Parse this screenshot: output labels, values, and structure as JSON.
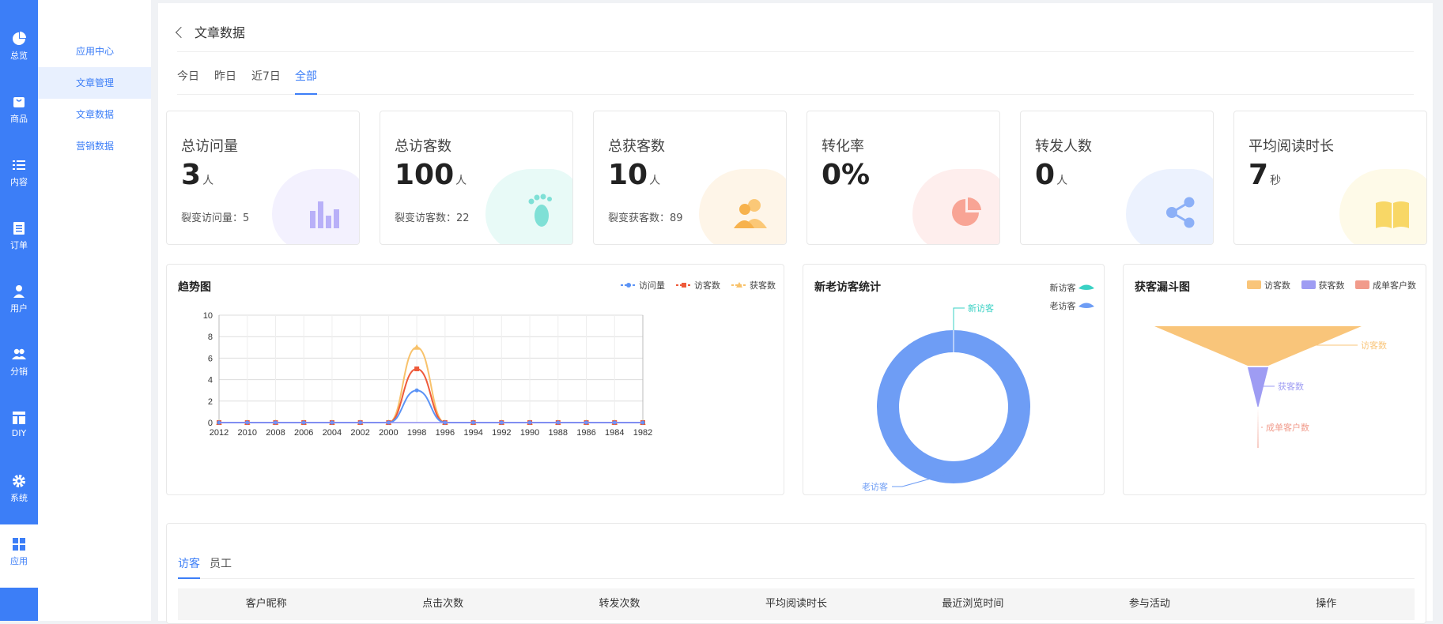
{
  "rail": [
    {
      "label": "总览",
      "icon": "pie-icon"
    },
    {
      "label": "商品",
      "icon": "bag-icon"
    },
    {
      "label": "内容",
      "icon": "list-icon"
    },
    {
      "label": "订单",
      "icon": "document-icon"
    },
    {
      "label": "用户",
      "icon": "user-icon"
    },
    {
      "label": "分销",
      "icon": "users-icon"
    },
    {
      "label": "DIY",
      "icon": "layout-icon"
    },
    {
      "label": "系统",
      "icon": "gear-icon"
    },
    {
      "label": "应用",
      "icon": "grid-icon"
    }
  ],
  "subnav": [
    "应用中心",
    "文章管理",
    "文章数据",
    "营销数据"
  ],
  "page_title": "文章数据",
  "tabs": [
    "今日",
    "昨日",
    "近7日",
    "全部"
  ],
  "stats": [
    {
      "label": "总访问量",
      "value": "3",
      "unit": "人",
      "sub": "裂变访问量：5",
      "color": "#7b6cf6",
      "icon": "bar-chart-icon"
    },
    {
      "label": "总访客数",
      "value": "100",
      "unit": "人",
      "sub": "裂变访客数：22",
      "color": "#3ad1c4",
      "icon": "footprint-icon"
    },
    {
      "label": "总获客数",
      "value": "10",
      "unit": "人",
      "sub": "裂变获客数：89",
      "color": "#f8b653",
      "icon": "users-icon"
    },
    {
      "label": "转化率",
      "value": "0%",
      "unit": "",
      "sub": "",
      "color": "#f57b6d",
      "icon": "pie-icon"
    },
    {
      "label": "转发人数",
      "value": "0",
      "unit": "人",
      "sub": "",
      "color": "#5b93f6",
      "icon": "share-icon"
    },
    {
      "label": "平均阅读时长",
      "value": "7",
      "unit": "秒",
      "sub": "",
      "color": "#f6cf4d",
      "icon": "book-icon"
    }
  ],
  "trend": {
    "title": "趋势图",
    "legend": [
      "访问量",
      "访客数",
      "获客数"
    ],
    "colors": [
      "#5b93f6",
      "#ee5a3a",
      "#f8c26b"
    ]
  },
  "visitor": {
    "title": "新老访客统计",
    "legend": [
      "新访客",
      "老访客"
    ],
    "label_new": "新访客",
    "label_old": "老访客",
    "colors": [
      "#3ad1c4",
      "#6e9df5"
    ]
  },
  "funnel": {
    "title": "获客漏斗图",
    "legend": [
      "访客数",
      "获客数",
      "成单客户数"
    ],
    "colors": [
      "#f9c57a",
      "#9e9cf3",
      "#f19b8b"
    ]
  },
  "chart_data": [
    {
      "type": "line",
      "title": "趋势图",
      "x": [
        "2012",
        "2010",
        "2008",
        "2006",
        "2004",
        "2002",
        "2000",
        "1998",
        "1996",
        "1994",
        "1992",
        "1990",
        "1988",
        "1986",
        "1984",
        "1982"
      ],
      "ylim": [
        0,
        10
      ],
      "yticks": [
        0,
        2,
        4,
        6,
        8,
        10
      ],
      "series": [
        {
          "name": "访问量",
          "values": [
            0,
            0,
            0,
            0,
            0,
            0,
            0,
            3,
            0,
            0,
            0,
            0,
            0,
            0,
            0,
            0
          ]
        },
        {
          "name": "访客数",
          "values": [
            0,
            0,
            0,
            0,
            0,
            0,
            0,
            5,
            0,
            0,
            0,
            0,
            0,
            0,
            0,
            0
          ]
        },
        {
          "name": "获客数",
          "values": [
            0,
            0,
            0,
            0,
            0,
            0,
            0,
            7,
            0,
            0,
            0,
            0,
            0,
            0,
            0,
            0
          ]
        }
      ],
      "grid": true,
      "legend": "top-right"
    },
    {
      "type": "pie",
      "title": "新老访客统计",
      "labels": [
        "新访客",
        "老访客"
      ],
      "values": [
        0,
        100
      ],
      "legend": "top-right"
    },
    {
      "type": "funnel",
      "title": "获客漏斗图",
      "labels": [
        "访客数",
        "获客数",
        "成单客户数"
      ],
      "values": [
        100,
        10,
        0
      ],
      "legend": "top-right"
    }
  ],
  "table": {
    "subtabs": [
      "访客",
      "员工"
    ],
    "columns": [
      "客户昵称",
      "点击次数",
      "转发次数",
      "平均阅读时长",
      "最近浏览时间",
      "参与活动",
      "操作"
    ]
  }
}
